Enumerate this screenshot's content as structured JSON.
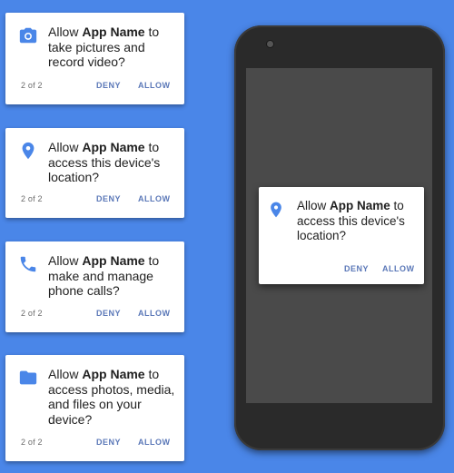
{
  "colors": {
    "background": "#4a86e8",
    "accent": "#4a86e8",
    "button_text": "#5b78b8"
  },
  "cards": [
    {
      "icon": "camera-icon",
      "prefix": "Allow ",
      "app_name": "App Name",
      "suffix": " to take pictures and record video?",
      "count": "2 of 2",
      "deny": "DENY",
      "allow": "ALLOW"
    },
    {
      "icon": "location-pin-icon",
      "prefix": "Allow ",
      "app_name": "App Name",
      "suffix": " to access this device's location?",
      "count": "2 of 2",
      "deny": "DENY",
      "allow": "ALLOW"
    },
    {
      "icon": "phone-icon",
      "prefix": "Allow ",
      "app_name": "App Name",
      "suffix": " to make and manage phone calls?",
      "count": "2 of 2",
      "deny": "DENY",
      "allow": "ALLOW"
    },
    {
      "icon": "folder-icon",
      "prefix": "Allow ",
      "app_name": "App Name",
      "suffix": " to access photos, media, and files on your device?",
      "count": "2 of 2",
      "deny": "DENY",
      "allow": "ALLOW"
    }
  ],
  "phone_dialog": {
    "icon": "location-pin-icon",
    "prefix": "Allow ",
    "app_name": "App Name",
    "suffix": " to access this device's location?",
    "deny": "DENY",
    "allow": "ALLOW"
  }
}
